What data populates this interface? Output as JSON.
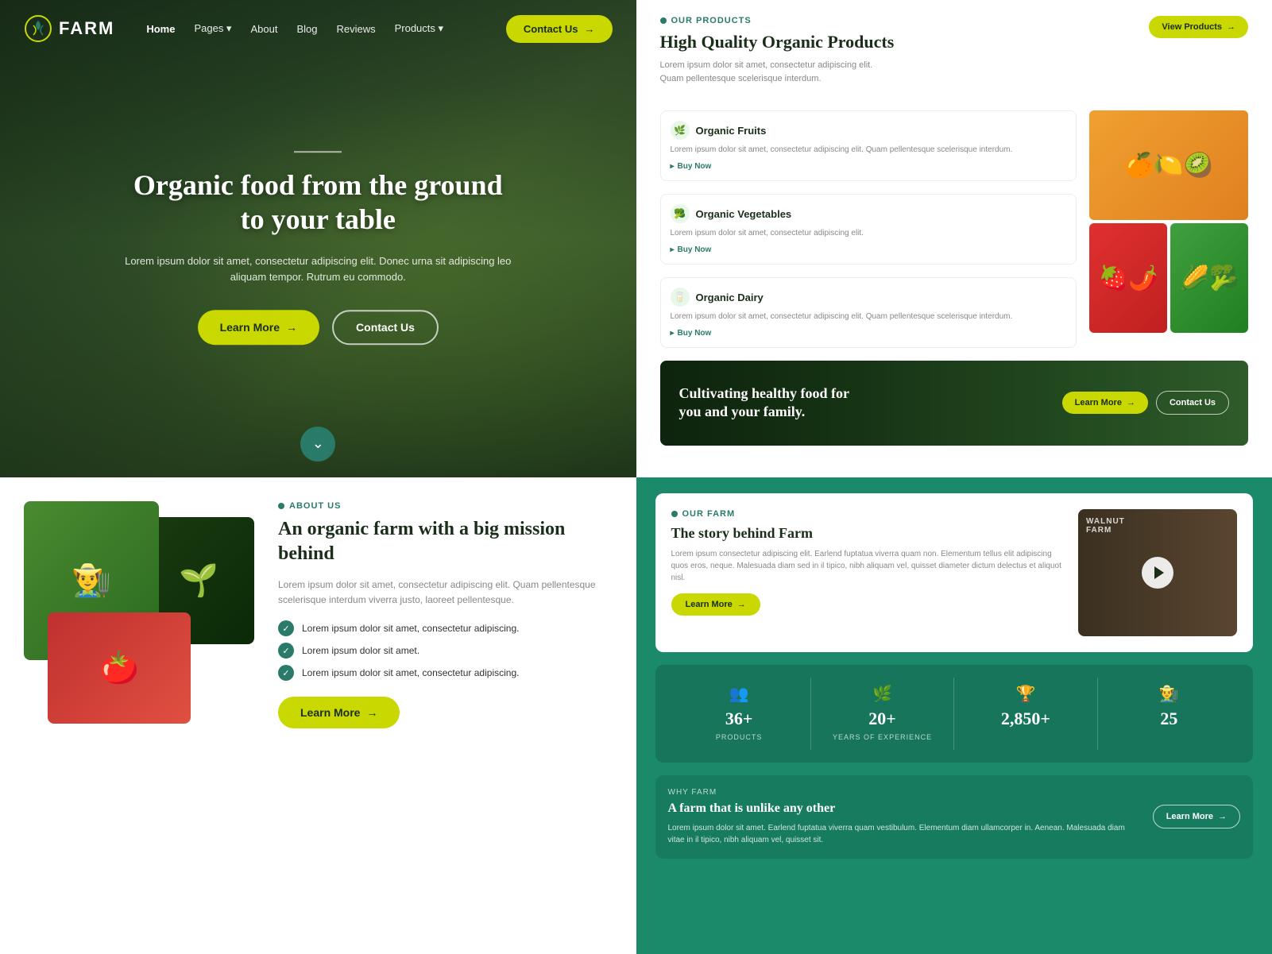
{
  "brand": {
    "name": "FARM",
    "logo_alt": "Farm logo"
  },
  "nav": {
    "links": [
      {
        "label": "Home",
        "active": true
      },
      {
        "label": "Pages",
        "has_dropdown": true
      },
      {
        "label": "About",
        "active": false
      },
      {
        "label": "Blog",
        "active": false
      },
      {
        "label": "Reviews",
        "active": false
      },
      {
        "label": "Products",
        "has_dropdown": true
      }
    ],
    "cta_label": "Contact Us",
    "cta_arrow": "→"
  },
  "hero": {
    "title": "Organic food from the ground to your table",
    "subtitle": "Lorem ipsum dolor sit amet, consectetur adipiscing elit. Donec urna sit adipiscing leo aliquam tempor. Rutrum eu commodo.",
    "btn_learn": "Learn More",
    "btn_contact": "Contact Us",
    "arrow": "→"
  },
  "products_section": {
    "eyebrow": "OUR PRODUCTS",
    "title": "High Quality Organic Products",
    "description": "Lorem ipsum dolor sit amet, consectetur adipiscing elit. Quam pellentesque scelerisque interdum.",
    "view_btn": "View Products",
    "arrow": "→",
    "items": [
      {
        "icon": "🌿",
        "name": "Organic Fruits",
        "desc": "Lorem ipsum dolor sit amet, consectetur adipiscing elit. Quam pellentesque scelerisque interdum.",
        "buy_label": "Buy Now"
      },
      {
        "icon": "🥦",
        "name": "Organic Vegetables",
        "desc": "Lorem ipsum dolor sit amet, consectetur adipiscing elit.",
        "buy_label": "Buy Now"
      },
      {
        "icon": "🥛",
        "name": "Organic Dairy",
        "desc": "Lorem ipsum dolor sit amet, consectetur adipiscing elit. Quam pellentesque scelerisque interdum.",
        "buy_label": "Buy Now"
      }
    ],
    "images": [
      "🍊",
      "🍓",
      "🌽"
    ]
  },
  "banner": {
    "title": "Cultivating healthy food for you and your family.",
    "btn_learn": "Learn More",
    "btn_contact": "Contact Us",
    "arrow": "→"
  },
  "about": {
    "eyebrow": "ABOUT US",
    "title": "An organic farm with a big mission behind",
    "description": "Lorem ipsum dolor sit amet, consectetur adipiscing elit. Quam pellentesque scelerisque interdum viverra justo, laoreet pellentesque.",
    "features": [
      "Lorem ipsum dolor sit amet, consectetur adipiscing.",
      "Lorem ipsum dolor sit amet.",
      "Lorem ipsum dolor sit amet, consectetur adipiscing."
    ],
    "learn_more_label": "Learn More",
    "arrow": "→"
  },
  "farm_story": {
    "eyebrow": "OUR FARM",
    "title": "The story behind Farm",
    "description": "Lorem ipsum consectetur adipiscing elit. Earlend fuptatua viverra quam non. Elementum tellus elit adipiscing quos eros, neque. Malesuada diam sed in il tipico, nibh aliquam vel, quisset diameter dictum delectus et aliquot nisl.",
    "learn_more_label": "Learn More",
    "arrow": "→",
    "walnut_label": "WALNUT FARM"
  },
  "stats": [
    {
      "icon": "👥",
      "number": "36+",
      "label": "PRODUCTS"
    },
    {
      "icon": "🌿",
      "number": "20+",
      "label": "YEARS OF EXPERIENCE"
    },
    {
      "icon": "🏆",
      "number": "2,850+",
      "label": ""
    },
    {
      "icon": "👨‍🌾",
      "number": "25",
      "label": ""
    }
  ],
  "why_farm": {
    "eyebrow": "WHY FARM",
    "title": "A farm that is unlike any other",
    "description": "Lorem ipsum dolor sit amet. Earlend fuptatua viverra quam vestibulum. Elementum diam ullamcorper in. Aenean. Malesuada diam vitae in il tipico, nibh aliquam vel, quisset sit.",
    "learn_more_label": "Learn More",
    "arrow": "→"
  }
}
